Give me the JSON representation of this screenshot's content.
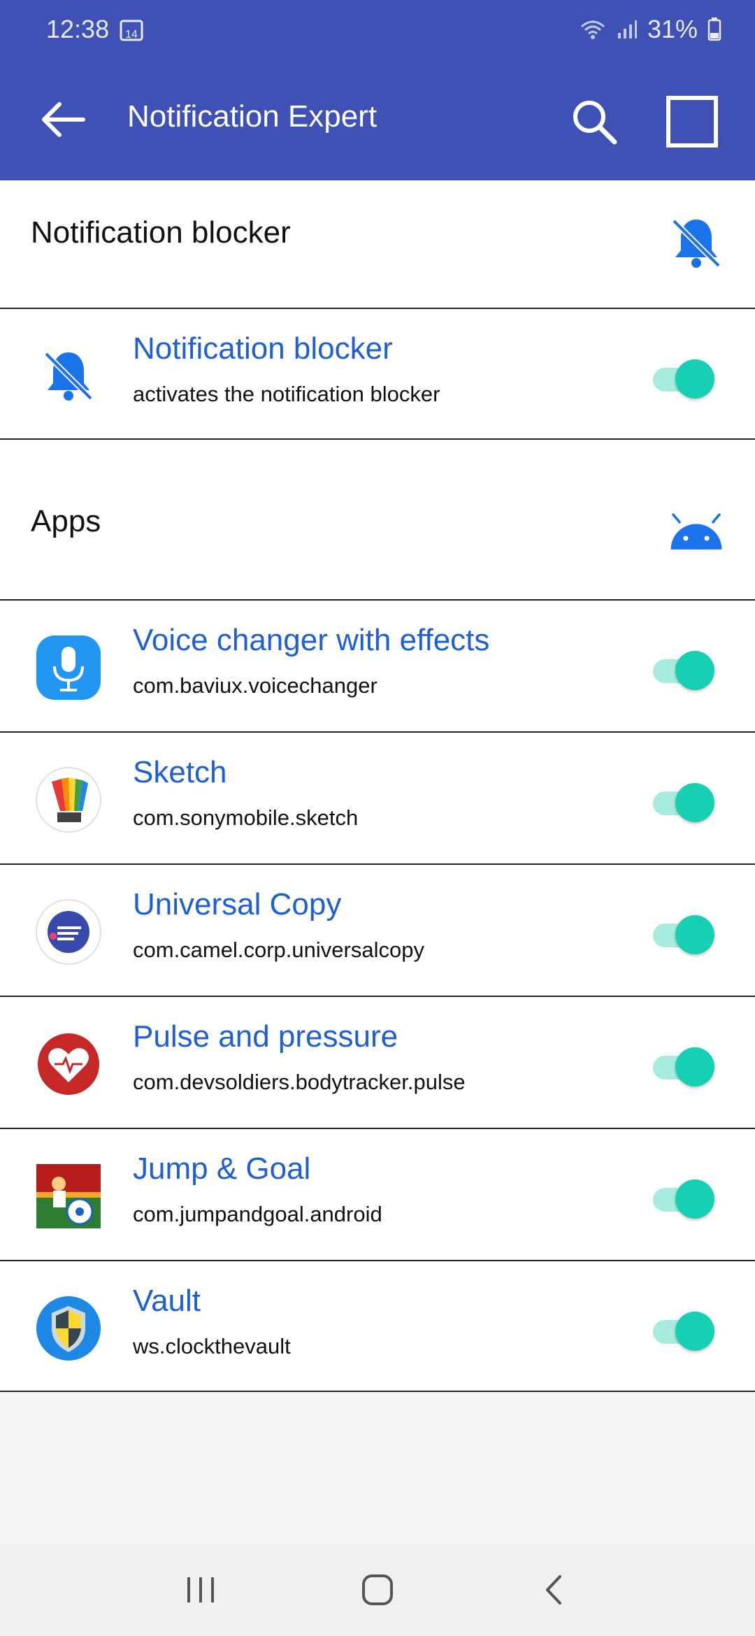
{
  "status_bar": {
    "time": "12:38",
    "calendar_badge": "14",
    "battery": "31%"
  },
  "app_bar": {
    "title": "Notification Expert"
  },
  "blocker_section": {
    "title": "Notification blocker",
    "item": {
      "title": "Notification blocker",
      "subtitle": "activates the notification blocker",
      "enabled": true
    }
  },
  "apps_section": {
    "title": "Apps",
    "items": [
      {
        "title": "Voice changer with effects",
        "subtitle": "com.baviux.voicechanger",
        "icon": "microphone-app-icon",
        "enabled": true
      },
      {
        "title": "Sketch",
        "subtitle": "com.sonymobile.sketch",
        "icon": "sketch-app-icon",
        "enabled": true
      },
      {
        "title": "Universal Copy",
        "subtitle": "com.camel.corp.universalcopy",
        "icon": "universal-copy-app-icon",
        "enabled": true
      },
      {
        "title": "Pulse and pressure",
        "subtitle": "com.devsoldiers.bodytracker.pulse",
        "icon": "heart-pulse-app-icon",
        "enabled": true
      },
      {
        "title": "Jump & Goal",
        "subtitle": "com.jumpandgoal.android",
        "icon": "soccer-app-icon",
        "enabled": true
      },
      {
        "title": "Vault",
        "subtitle": "ws.clockthevault",
        "icon": "shield-app-icon",
        "enabled": true
      }
    ]
  },
  "colors": {
    "primary": "#3f51b5",
    "accent_blue": "#1e5fd6",
    "toggle_on": "#17d0b4"
  }
}
